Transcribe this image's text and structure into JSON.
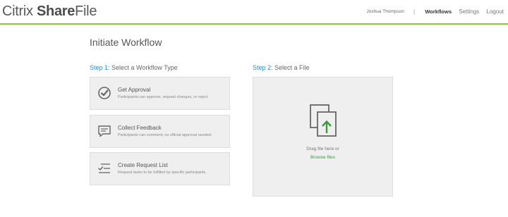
{
  "header": {
    "logo": {
      "part1": "Citrix ",
      "part2": "Share",
      "part3": "File"
    },
    "user_name": "Joshua Thompson",
    "separator": "|",
    "nav": [
      {
        "label": "Workflows",
        "active": true
      },
      {
        "label": "Settings",
        "active": false
      },
      {
        "label": "Logout",
        "active": false
      }
    ]
  },
  "main": {
    "title": "Initiate Workflow",
    "step1": {
      "num": "Step 1:",
      "label": " Select a Workflow Type"
    },
    "step2": {
      "num": "Step 2:",
      "label": " Select a File"
    },
    "workflow_types": [
      {
        "icon": "approval-check-icon",
        "title": "Get Approval",
        "description": "Participants can approve, request changes, or reject."
      },
      {
        "icon": "feedback-speech-bubble-icon",
        "title": "Collect Feedback",
        "description": "Participants can comment; no official approval needed."
      },
      {
        "icon": "request-list-icon",
        "title": "Create Request List",
        "description": "Request tasks to be fulfilled by specific participants."
      }
    ],
    "dropzone": {
      "icon": "file-upload-icon",
      "drag_text": "Drag file here or",
      "browse_label": "Browse files"
    }
  },
  "colors": {
    "accent_green": "#8cc540",
    "step_blue": "#2a8dd4",
    "link_green": "#3c9a3c",
    "card_bg": "#efefef"
  }
}
